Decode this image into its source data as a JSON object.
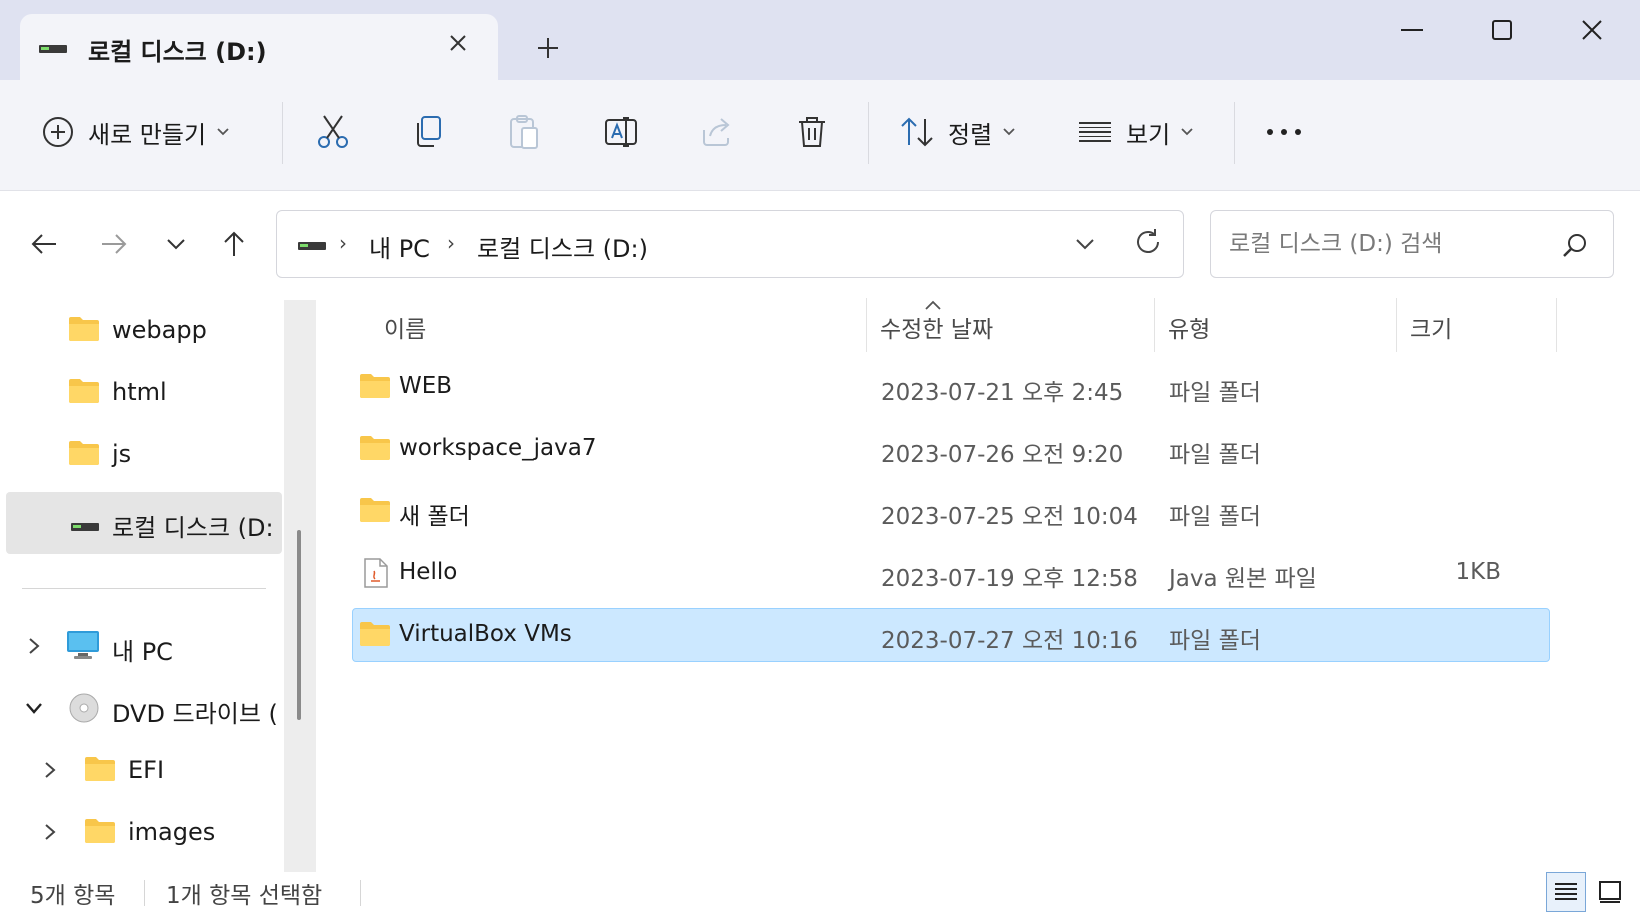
{
  "window": {
    "tab_title": "로컬 디스크 (D:)",
    "icons": {
      "tab_drive": "drive-icon",
      "tab_close": "close-icon",
      "new_tab": "plus-icon",
      "minimize": "minimize-icon",
      "maximize": "maximize-icon",
      "close": "close-icon"
    }
  },
  "toolbar": {
    "new_label": "새로 만들기",
    "sort_label": "정렬",
    "view_label": "보기",
    "icons": [
      "plus-circle-icon",
      "cut-icon",
      "copy-icon",
      "paste-icon",
      "rename-icon",
      "share-icon",
      "delete-icon",
      "sort-icon",
      "view-icon",
      "more-icon"
    ]
  },
  "address": {
    "crumbs": [
      "내 PC",
      "로컬 디스크 (D:)"
    ],
    "search_placeholder": "로컬 디스크 (D:) 검색"
  },
  "sidebar": {
    "items": [
      {
        "label": "webapp",
        "icon": "folder-icon"
      },
      {
        "label": "html",
        "icon": "folder-icon"
      },
      {
        "label": "js",
        "icon": "folder-icon"
      },
      {
        "label": "로컬 디스크 (D:",
        "icon": "drive-icon",
        "selected": true
      },
      {
        "label": "내 PC",
        "icon": "pc-icon",
        "expander": "chevron-right-icon"
      },
      {
        "label": "DVD 드라이브 (",
        "icon": "dvd-icon",
        "expander": "chevron-down-icon"
      },
      {
        "label": "EFI",
        "icon": "folder-icon",
        "expander": "chevron-right-icon"
      },
      {
        "label": "images",
        "icon": "folder-icon",
        "expander": "chevron-right-icon"
      }
    ]
  },
  "columns": {
    "name": "이름",
    "date": "수정한 날짜",
    "type": "유형",
    "size": "크기"
  },
  "files": [
    {
      "name": "WEB",
      "date": "2023-07-21 오후 2:45",
      "type": "파일 폴더",
      "size": "",
      "icon": "folder-icon"
    },
    {
      "name": "workspace_java7",
      "date": "2023-07-26 오전 9:20",
      "type": "파일 폴더",
      "size": "",
      "icon": "folder-icon"
    },
    {
      "name": "새 폴더",
      "date": "2023-07-25 오전 10:04",
      "type": "파일 폴더",
      "size": "",
      "icon": "folder-icon"
    },
    {
      "name": "Hello",
      "date": "2023-07-19 오후 12:58",
      "type": "Java 원본 파일",
      "size": "1KB",
      "icon": "java-file-icon"
    },
    {
      "name": "VirtualBox VMs",
      "date": "2023-07-27 오전 10:16",
      "type": "파일 폴더",
      "size": "",
      "icon": "folder-icon",
      "selected": true
    }
  ],
  "status": {
    "count": "5개 항목",
    "selected": "1개 항목 선택함"
  },
  "colors": {
    "selection_bg": "#cce8ff",
    "selection_border": "#99d1ff",
    "folder": "#f8c64a",
    "titlebar": "#dfe2f1"
  }
}
